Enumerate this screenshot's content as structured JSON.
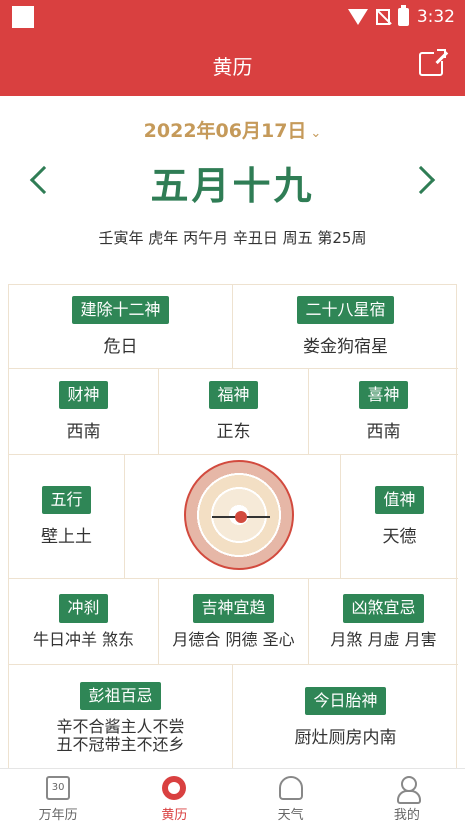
{
  "status": {
    "time": "3:32"
  },
  "header": {
    "title": "黄历"
  },
  "date": {
    "solar": "2022年06月17日",
    "lunar": "五月十九",
    "ganzhi": "壬寅年 虎年 丙午月 辛丑日 周五 第25周"
  },
  "grid": {
    "jianchu": {
      "label": "建除十二神",
      "value": "危日"
    },
    "xingxiu": {
      "label": "二十八星宿",
      "value": "娄金狗宿星"
    },
    "caishen": {
      "label": "财神",
      "value": "西南"
    },
    "fushen": {
      "label": "福神",
      "value": "正东"
    },
    "xishen": {
      "label": "喜神",
      "value": "西南"
    },
    "wuxing": {
      "label": "五行",
      "value": "壁上土"
    },
    "zhishen": {
      "label": "值神",
      "value": "天德"
    },
    "chongsha": {
      "label": "冲刹",
      "value": "牛日冲羊 煞东"
    },
    "jishen": {
      "label": "吉神宜趋",
      "value": "月德合 阴德 圣心"
    },
    "xiongsha": {
      "label": "凶煞宜忌",
      "value": "月煞 月虚 月害"
    },
    "pengzu": {
      "label": "彭祖百忌",
      "line1": "辛不合酱主人不尝",
      "line2": "丑不冠带主不还乡"
    },
    "taishen": {
      "label": "今日胎神",
      "value": "厨灶厕房内南"
    }
  },
  "tabs": [
    {
      "label": "万年历",
      "icon": "calendar-icon",
      "num": "30"
    },
    {
      "label": "黄历",
      "icon": "yinyang-icon"
    },
    {
      "label": "天气",
      "icon": "weather-icon"
    },
    {
      "label": "我的",
      "icon": "user-icon"
    }
  ],
  "colors": {
    "brand": "#d94040",
    "green": "#2f7d55",
    "gold": "#c59a5a"
  }
}
